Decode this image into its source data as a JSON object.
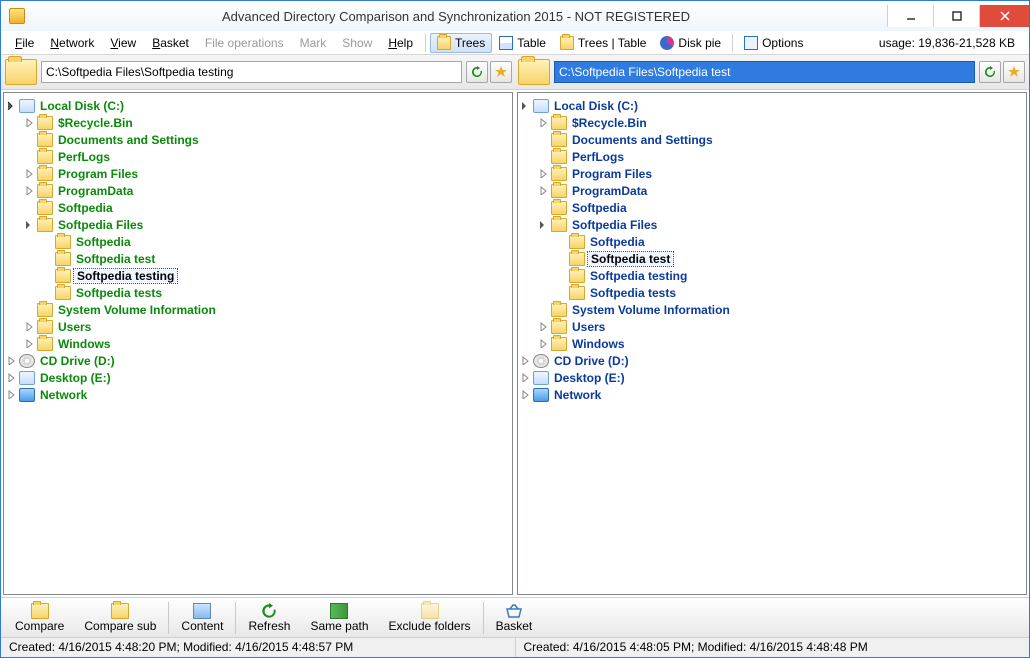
{
  "title": "Advanced Directory Comparison and Synchronization 2015 - NOT REGISTERED",
  "menu": {
    "file": "File",
    "network": "Network",
    "view": "View",
    "basket": "Basket",
    "fileops": "File operations",
    "mark": "Mark",
    "show": "Show",
    "help": "Help"
  },
  "viewbtns": {
    "trees": "Trees",
    "table": "Table",
    "treestable": "Trees | Table",
    "diskpie": "Disk pie",
    "options": "Options"
  },
  "usage": "usage: 19,836-21,528 KB",
  "paths": {
    "left": "C:\\Softpedia Files\\Softpedia testing",
    "right": "C:\\Softpedia Files\\Softpedia test"
  },
  "tree": {
    "root": "Local Disk (C:)",
    "items": {
      "recycle": "$Recycle.Bin",
      "docsettings": "Documents and Settings",
      "perflogs": "PerfLogs",
      "progfiles": "Program Files",
      "progdata": "ProgramData",
      "softpedia": "Softpedia",
      "softfiles": "Softpedia Files",
      "sub_softpedia": "Softpedia",
      "sub_test": "Softpedia test",
      "sub_testing": "Softpedia testing",
      "sub_tests": "Softpedia tests",
      "sysvol": "System Volume Information",
      "users": "Users",
      "windows": "Windows"
    },
    "roots": {
      "cd": "CD Drive (D:)",
      "desktop": "Desktop (E:)",
      "network": "Network"
    }
  },
  "bottom": {
    "compare": "Compare",
    "comparesub": "Compare sub",
    "content": "Content",
    "refresh": "Refresh",
    "samepath": "Same path",
    "exclude": "Exclude folders",
    "basket": "Basket"
  },
  "status": {
    "left": "Created: 4/16/2015 4:48:20 PM; Modified: 4/16/2015 4:48:57 PM",
    "right": "Created: 4/16/2015 4:48:05 PM; Modified: 4/16/2015 4:48:48 PM"
  }
}
